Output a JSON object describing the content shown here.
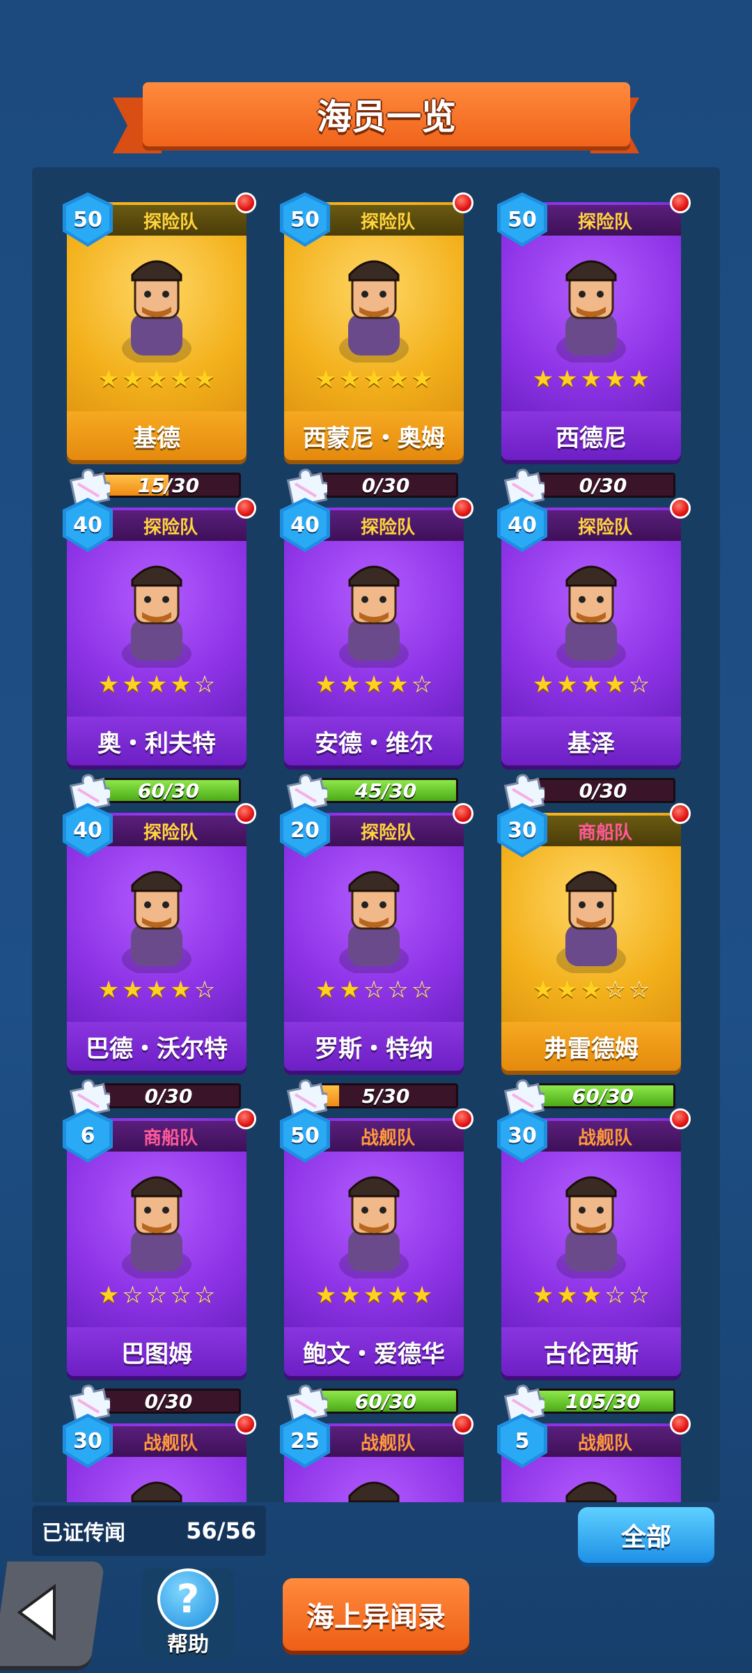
{
  "title": "海员一览",
  "colors": {
    "background": "#1f4e83",
    "gold_card": "#f3b11c",
    "purple_card": "#8d33e6",
    "progress_orange": "#f08a12",
    "progress_green": "#4caa18"
  },
  "crew": [
    {
      "level": "50",
      "team": "探险队",
      "team_type": "explore",
      "name": "基德",
      "rarity": "gold",
      "stars": 5,
      "progress": "15/30",
      "fill": 0.5,
      "fill_color": "orange"
    },
    {
      "level": "50",
      "team": "探险队",
      "team_type": "explore",
      "name": "西蒙尼・奥姆",
      "rarity": "gold",
      "stars": 5,
      "progress": "0/30",
      "fill": 0,
      "fill_color": "orange"
    },
    {
      "level": "50",
      "team": "探险队",
      "team_type": "explore",
      "name": "西德尼",
      "rarity": "purple",
      "stars": 5,
      "progress": "0/30",
      "fill": 0,
      "fill_color": "orange"
    },
    {
      "level": "40",
      "team": "探险队",
      "team_type": "explore",
      "name": "奥・利夫特",
      "rarity": "purple",
      "stars": 4,
      "progress": "60/30",
      "fill": 1,
      "fill_color": "green"
    },
    {
      "level": "40",
      "team": "探险队",
      "team_type": "explore",
      "name": "安德・维尔",
      "rarity": "purple",
      "stars": 4,
      "progress": "45/30",
      "fill": 1,
      "fill_color": "green"
    },
    {
      "level": "40",
      "team": "探险队",
      "team_type": "explore",
      "name": "基泽",
      "rarity": "purple",
      "stars": 4,
      "progress": "0/30",
      "fill": 0,
      "fill_color": "orange"
    },
    {
      "level": "40",
      "team": "探险队",
      "team_type": "explore",
      "name": "巴德・沃尔特",
      "rarity": "purple",
      "stars": 4,
      "progress": "0/30",
      "fill": 0,
      "fill_color": "orange"
    },
    {
      "level": "20",
      "team": "探险队",
      "team_type": "explore",
      "name": "罗斯・特纳",
      "rarity": "purple",
      "stars": 2,
      "progress": "5/30",
      "fill": 0.1667,
      "fill_color": "orange"
    },
    {
      "level": "30",
      "team": "商船队",
      "team_type": "merchant",
      "name": "弗雷德姆",
      "rarity": "gold",
      "stars": 3,
      "progress": "60/30",
      "fill": 1,
      "fill_color": "green"
    },
    {
      "level": "6",
      "team": "商船队",
      "team_type": "merchant",
      "name": "巴图姆",
      "rarity": "purple",
      "stars": 1,
      "progress": "0/30",
      "fill": 0,
      "fill_color": "orange"
    },
    {
      "level": "50",
      "team": "战舰队",
      "team_type": "battle",
      "name": "鲍文・爱德华",
      "rarity": "purple",
      "stars": 5,
      "progress": "60/30",
      "fill": 1,
      "fill_color": "green"
    },
    {
      "level": "30",
      "team": "战舰队",
      "team_type": "battle",
      "name": "古伦西斯",
      "rarity": "purple",
      "stars": 3,
      "progress": "105/30",
      "fill": 1,
      "fill_color": "green"
    },
    {
      "level": "30",
      "team": "战舰队",
      "team_type": "battle",
      "name": "",
      "rarity": "purple",
      "stars": 0,
      "progress": "",
      "fill": 0,
      "fill_color": "orange"
    },
    {
      "level": "25",
      "team": "战舰队",
      "team_type": "battle",
      "name": "",
      "rarity": "purple",
      "stars": 0,
      "progress": "",
      "fill": 0,
      "fill_color": "orange"
    },
    {
      "level": "5",
      "team": "战舰队",
      "team_type": "battle",
      "name": "",
      "rarity": "purple",
      "stars": 0,
      "progress": "",
      "fill": 0,
      "fill_color": "orange"
    }
  ],
  "footer": {
    "count_label": "已证传闻",
    "count_value": "56/56",
    "all_button": "全部",
    "help_icon": "?",
    "help_label": "帮助",
    "sea_button": "海上异闻录",
    "back_icon": "back-arrow-icon"
  }
}
